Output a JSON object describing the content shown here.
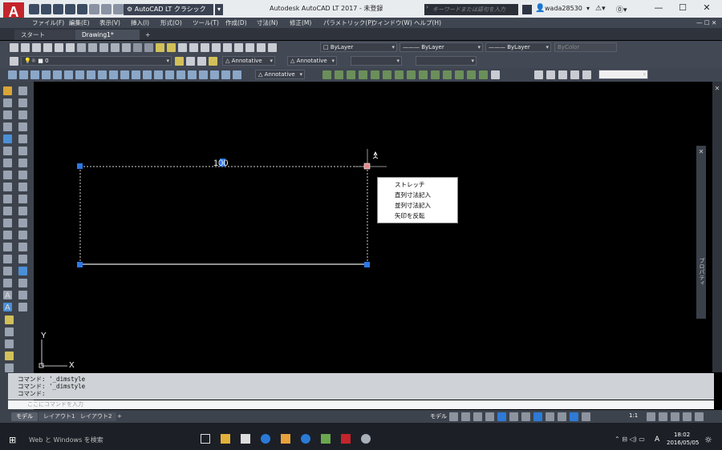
{
  "app": {
    "logo_letter": "A",
    "logo_sub": "LT",
    "window_title": "Autodesk AutoCAD LT 2017 - 未登録",
    "workspace": "AutoCAD LT クラシック",
    "search_placeholder": "キーワードまたは語句を入力",
    "username": "wada28530",
    "window_controls": [
      "—",
      "☐",
      "✕"
    ]
  },
  "menu": [
    "ファイル(F)",
    "編集(E)",
    "表示(V)",
    "挿入(I)",
    "形式(O)",
    "ツール(T)",
    "作成(D)",
    "寸法(N)",
    "修正(M)",
    "パラメトリック(P)",
    "ウィンドウ(W)",
    "ヘルプ(H)"
  ],
  "tabs": [
    {
      "label": "スタート"
    },
    {
      "label": "Drawing1*"
    },
    {
      "label": "+"
    }
  ],
  "properties_row": {
    "color": "ByLayer",
    "linetype": "ByLayer",
    "lineweight": "ByLayer",
    "plotstyle": "ByColor"
  },
  "layer_row": {
    "layer": "0",
    "text_style": "Annotative",
    "dim_style": "Annotative"
  },
  "dim_row": {
    "annotative": "Annotative"
  },
  "drawing": {
    "dimension_text": "100",
    "ucs_x": "X",
    "ucs_y": "Y"
  },
  "context_menu": [
    "ストレッチ",
    "直列寸法記入",
    "並列寸法記入",
    "矢印を反転"
  ],
  "command_history": [
    "コマンド: '_dimstyle",
    "コマンド: '_dimstyle",
    "コマンド:"
  ],
  "command_prompt": "ここにコマンドを入力",
  "layout_tabs": [
    "モデル",
    "レイアウト1",
    "レイアウト2",
    "+"
  ],
  "status": {
    "model": "モデル",
    "scale": "1:1"
  },
  "properties_palette_label": "プロパティ",
  "taskbar": {
    "search": "Web と Windows を検索",
    "time": "18:02",
    "date": "2016/05/05",
    "ime": "A"
  }
}
